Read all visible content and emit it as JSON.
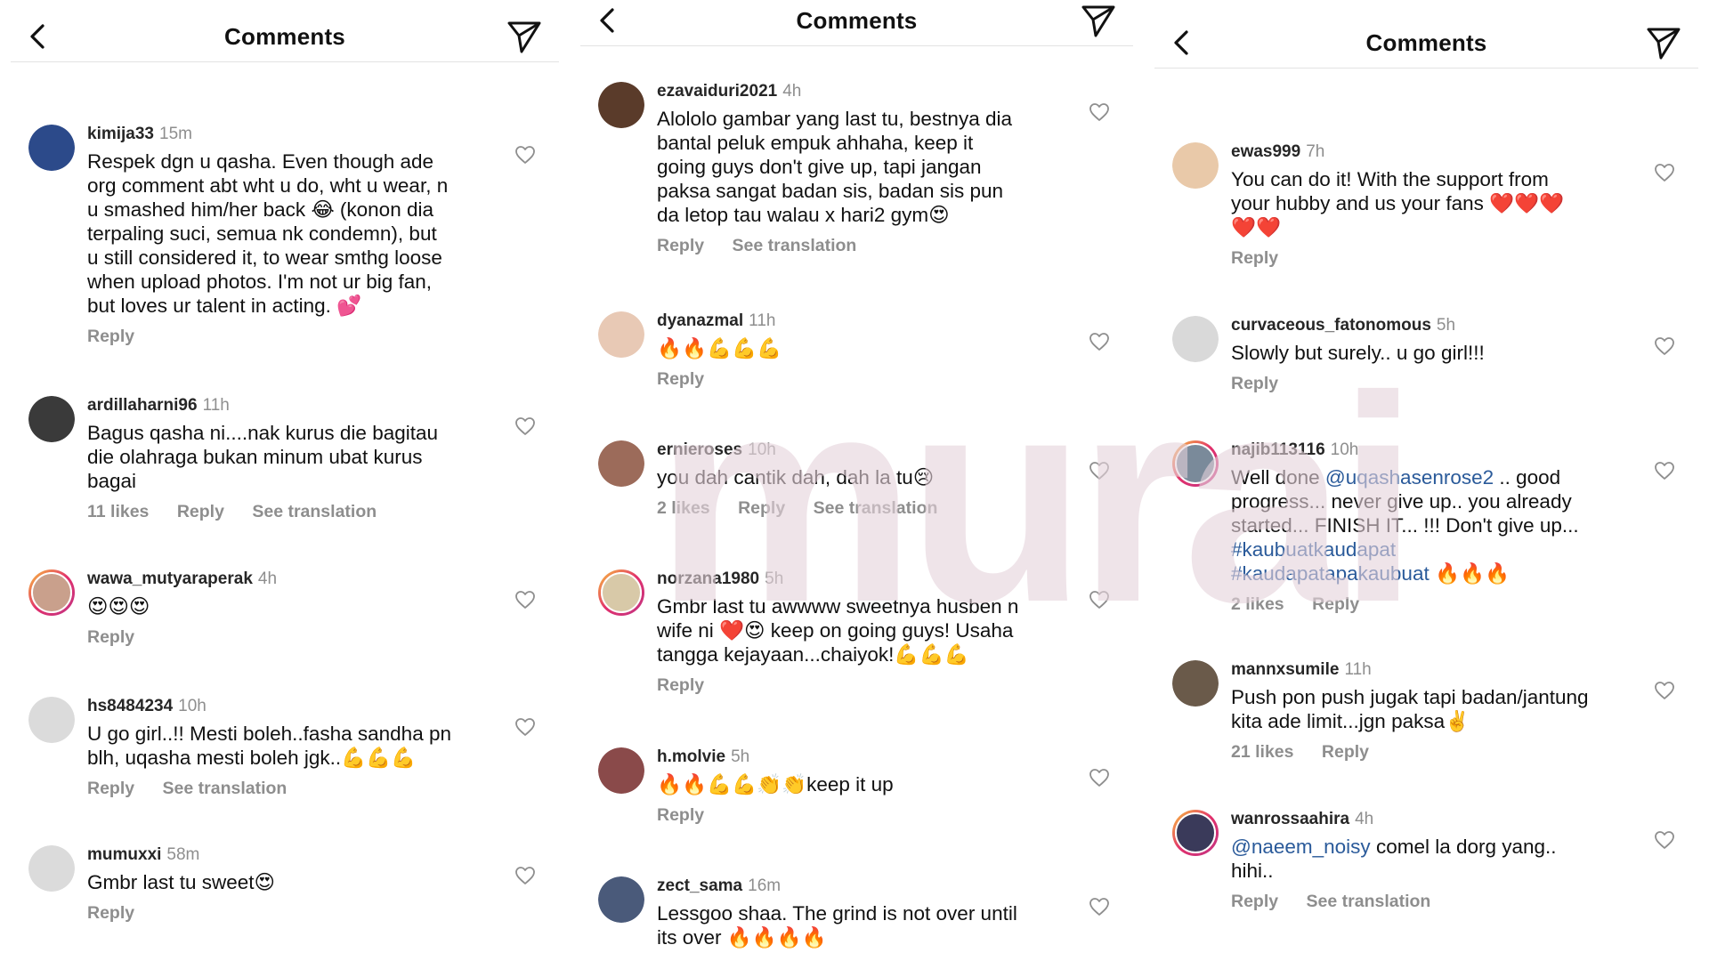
{
  "panels": [
    {
      "header": {
        "title": "Comments",
        "back_icon": "chevron-left-icon",
        "send_icon": "send-icon"
      },
      "comments": [
        {
          "username": "kimija33",
          "time": "15m",
          "text": "Respek dgn u qasha. Even though ade\norg comment abt wht u do, wht u wear, n\nu smashed him/her back 😂 (konon dia\nterpaling suci, semua nk condemn), but\nu still considered it, to wear smthg loose\nwhen upload photos. I'm not ur big fan,\nbut loves ur talent in acting. 💕",
          "likes": "",
          "reply": "Reply",
          "translation": "",
          "avatar_color": "#2c4a8a",
          "ring": false
        },
        {
          "username": "ardillaharni96",
          "time": "11h",
          "text": "Bagus qasha ni....nak kurus die bagitau\ndie olahraga bukan minum ubat kurus\nbagai",
          "likes": "11 likes",
          "reply": "Reply",
          "translation": "See translation",
          "avatar_color": "#3a3a3a",
          "ring": false
        },
        {
          "username": "wawa_mutyaraperak",
          "time": "4h",
          "text": "😍😍😍",
          "likes": "",
          "reply": "Reply",
          "translation": "",
          "avatar_color": "#c9a08c",
          "ring": true
        },
        {
          "username": "hs8484234",
          "time": "10h",
          "text": "U go girl..!! Mesti boleh..fasha sandha pn\nblh, uqasha mesti boleh jgk..💪💪💪",
          "likes": "",
          "reply": "Reply",
          "translation": "See translation",
          "avatar_color": "#dbdbdb",
          "ring": false
        },
        {
          "username": "mumuxxi",
          "time": "58m",
          "text": "Gmbr last tu sweet😍",
          "likes": "",
          "reply": "Reply",
          "translation": "",
          "avatar_color": "#dbdbdb",
          "ring": false
        }
      ]
    },
    {
      "header": {
        "title": "Comments",
        "back_icon": "chevron-left-icon",
        "send_icon": "send-icon"
      },
      "comments": [
        {
          "username": "ezavaiduri2021",
          "time": "4h",
          "text": "Alololo gambar yang last tu, bestnya dia\nbantal peluk empuk ahhaha, keep it\ngoing guys don't give up, tapi jangan\npaksa sangat badan sis, badan sis pun\nda letop tau walau x hari2 gym😍",
          "likes": "",
          "reply": "Reply",
          "translation": "See translation",
          "avatar_color": "#5a3b2a",
          "ring": false
        },
        {
          "username": "dyanazmal",
          "time": "11h",
          "text": "🔥🔥💪💪💪",
          "likes": "",
          "reply": "Reply",
          "translation": "",
          "avatar_color": "#e8c9b5",
          "ring": false
        },
        {
          "username": "ernieroses",
          "time": "10h",
          "text": "you dah cantik dah, dah la tu😢",
          "likes": "2 likes",
          "reply": "Reply",
          "translation": "See translation",
          "avatar_color": "#9c6b5a",
          "ring": false
        },
        {
          "username": "norzana1980",
          "time": "5h",
          "text": "Gmbr last tu awwww sweetnya husben n\nwife ni ❤️😍 keep on going guys! Usaha\ntangga kejayaan...chaiyok!💪💪💪",
          "likes": "",
          "reply": "Reply",
          "translation": "",
          "avatar_color": "#d8c9a8",
          "ring": true
        },
        {
          "username": "h.molvie",
          "time": "5h",
          "text": "🔥🔥💪💪👏👏keep it up",
          "likes": "",
          "reply": "Reply",
          "translation": "",
          "avatar_color": "#8a4a4a",
          "ring": false
        },
        {
          "username": "zect_sama",
          "time": "16m",
          "text": "Lessgoo shaa. The grind is not over until\nits over 🔥🔥🔥🔥",
          "likes": "",
          "reply": "",
          "translation": "",
          "avatar_color": "#4a5a7a",
          "ring": false
        }
      ]
    },
    {
      "header": {
        "title": "Comments",
        "back_icon": "chevron-left-icon",
        "send_icon": "send-icon"
      },
      "comments": [
        {
          "username": "ewas999",
          "time": "7h",
          "text": "You can do it! With the support from\nyour hubby and us your fans ❤️❤️❤️\n❤️❤️",
          "likes": "",
          "reply": "Reply",
          "translation": "",
          "avatar_color": "#e9c9a9",
          "ring": false
        },
        {
          "username": "curvaceous_fatonomous",
          "time": "5h",
          "text": "Slowly but surely.. u go girl!!!",
          "likes": "",
          "reply": "Reply",
          "translation": "",
          "avatar_color": "#d9d9d9",
          "ring": false
        },
        {
          "username": "najib113116",
          "time": "10h",
          "text": "Well done @uqashasenrose2 .. good\nprogress... never give up.. you already\nstarted... FINISH IT... !!! Don't give up...\n#kaubuatkaudapat\n#kaudapatapakaubuat 🔥🔥🔥",
          "likes": "2 likes",
          "reply": "Reply",
          "translation": "",
          "avatar_color": "#7a8a9a",
          "ring": true
        },
        {
          "username": "mannxsumile",
          "time": "11h",
          "text": "Push pon push jugak tapi badan/jantung\nkita ade limit...jgn paksa✌️",
          "likes": "21 likes",
          "reply": "Reply",
          "translation": "",
          "avatar_color": "#6a5a4a",
          "ring": false
        },
        {
          "username": "wanrossaahira",
          "time": "4h",
          "text": "@naeem_noisy comel la dorg yang..\nhihi..",
          "likes": "",
          "reply": "Reply",
          "translation": "See translation",
          "avatar_color": "#3a3a5a",
          "ring": true
        }
      ]
    }
  ],
  "watermark": {
    "text": "murai",
    "color": "#e6d3db"
  },
  "icons": {
    "heart": "heart-outline-icon"
  }
}
